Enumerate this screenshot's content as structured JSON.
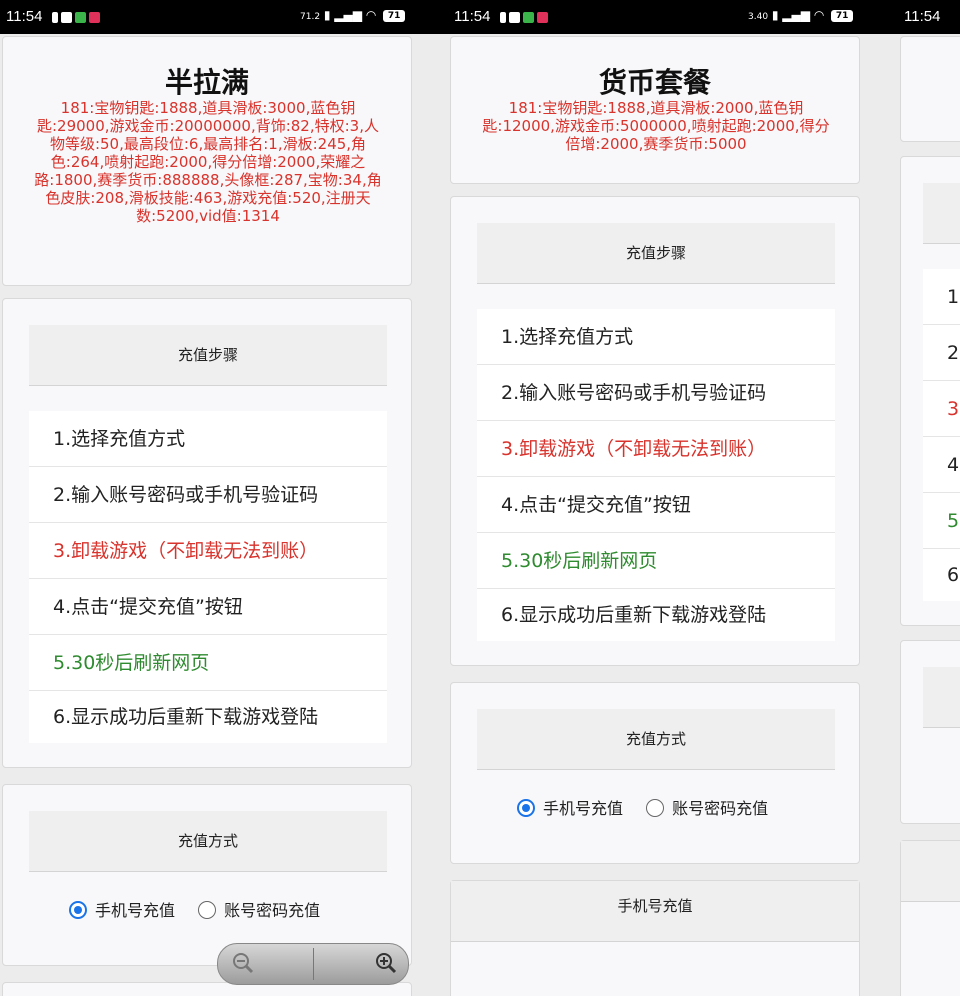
{
  "status_bar": {
    "time": "11:54",
    "network_left": "71.2",
    "network_mid": "3.40",
    "battery": "71"
  },
  "left": {
    "title": "半拉满",
    "desc": "181:宝物钥匙:1888,道具滑板:3000,蓝色钥匙:29000,游戏金币:20000000,背饰:82,特权:3,人物等级:50,最高段位:6,最高排名:1,滑板:245,角色:264,喷射起跑:2000,得分倍增:2000,荣耀之路:1800,赛季货币:888888,头像框:287,宝物:34,角色皮肤:208,滑板技能:463,游戏充值:520,注册天数:5200,vid值:1314"
  },
  "mid": {
    "title": "货币套餐",
    "desc": "181:宝物钥匙:1888,道具滑板:2000,蓝色钥匙:12000,游戏金币:5000000,喷射起跑:2000,得分倍增:2000,赛季货币:5000"
  },
  "steps_header": "充值步骤",
  "steps": [
    {
      "label": "1.选择充值方式",
      "color": "normal"
    },
    {
      "label": "2.输入账号密码或手机号验证码",
      "color": "normal"
    },
    {
      "label": "3.卸载游戏（不卸载无法到账）",
      "color": "red"
    },
    {
      "label": "4.点击“提交充值”按钮",
      "color": "normal"
    },
    {
      "label": "5.30秒后刷新网页",
      "color": "green"
    },
    {
      "label": "6.显示成功后重新下载游戏登陆",
      "color": "normal"
    }
  ],
  "method_header": "充值方式",
  "methods": {
    "phone": "手机号充值",
    "account": "账号密码充值",
    "selected": "phone"
  },
  "phone_section_header": "手机号充值",
  "right_partial_steps": [
    "1.",
    "2",
    "3",
    "4",
    "5",
    "6"
  ],
  "colors": {
    "red": "#d8332c",
    "green": "#2f8b2f",
    "accent": "#1a73e8"
  },
  "icons": [
    "zoom-out-icon",
    "zoom-in-icon",
    "wifi-icon",
    "signal-icon",
    "battery-icon"
  ]
}
